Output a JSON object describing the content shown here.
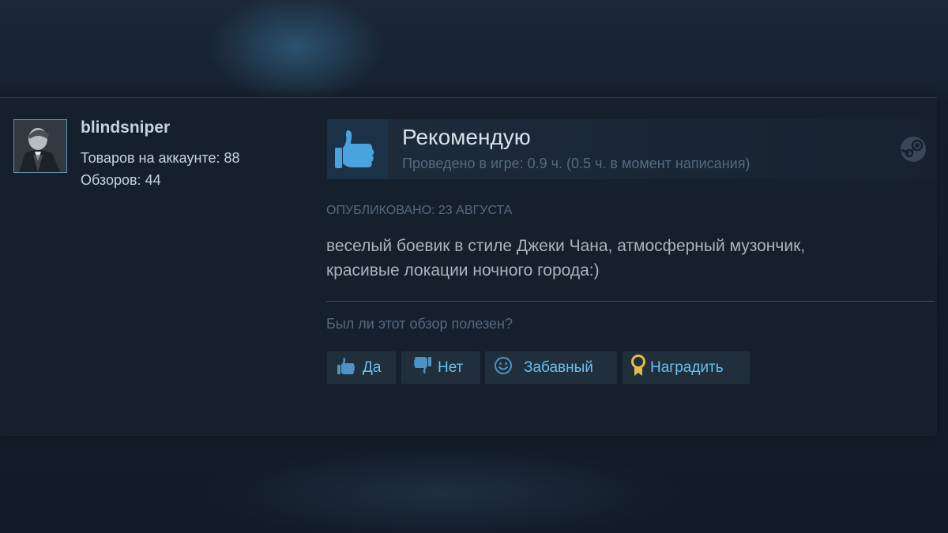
{
  "author": {
    "username": "blindsniper",
    "products_label": "Товаров на аккаунте: 88",
    "reviews_label": "Обзоров: 44"
  },
  "review": {
    "verdict": "Рекомендую",
    "hours": "Проведено в игре: 0.9 ч. (0.5 ч. в момент написания)",
    "posted": "ОПУБЛИКОВАНО: 23 АВГУСТА",
    "text_line1": "веселый боевик в стиле Джеки Чана, атмосферный музончик,",
    "text_line2": "красивые локации ночного города:)"
  },
  "feedback": {
    "question": "Был ли этот обзор полезен?",
    "yes_label": "Да",
    "no_label": "Нет",
    "funny_label": "Забавный",
    "award_label": "Наградить"
  },
  "colors": {
    "accent": "#66c0f4",
    "thumb": "#4aa3df",
    "award": "#e4b84a"
  },
  "icons": {
    "recommend": "thumbs-up-icon",
    "platform": "steam-logo-icon",
    "yes": "thumbs-up-icon",
    "no": "thumbs-down-icon",
    "funny": "smiley-icon",
    "award": "award-medal-icon"
  }
}
